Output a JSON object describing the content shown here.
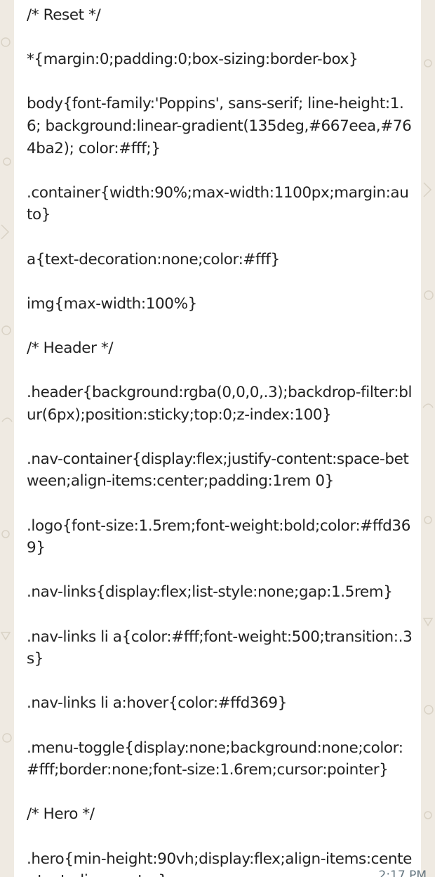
{
  "message": {
    "text": "/* Reset */\n\n*{margin:0;padding:0;box-sizing:border-box}\n\nbody{font-family:'Poppins', sans-serif; line-height:1.6; background:linear-gradient(135deg,#667eea,#764ba2); color:#fff;}\n\n.container{width:90%;max-width:1100px;margin:auto}\n\na{text-decoration:none;color:#fff}\n\nimg{max-width:100%}\n\n/* Header */\n\n.header{background:rgba(0,0,0,.3);backdrop-filter:blur(6px);position:sticky;top:0;z-index:100}\n\n.nav-container{display:flex;justify-content:space-between;align-items:center;padding:1rem 0}\n\n.logo{font-size:1.5rem;font-weight:bold;color:#ffd369}\n\n.nav-links{display:flex;list-style:none;gap:1.5rem}\n\n.nav-links li a{color:#fff;font-weight:500;transition:.3s}\n\n.nav-links li a:hover{color:#ffd369}\n\n.menu-toggle{display:none;background:none;color:#fff;border:none;font-size:1.6rem;cursor:pointer}\n\n/* Hero */\n\n.hero{min-height:90vh;display:flex;align-items:center;text-align:center}",
    "time": "2:17 PM"
  },
  "colors": {
    "wallpaper": "#efeae2",
    "bubble": "#ffffff",
    "text": "#222222",
    "timestamp": "#667781"
  }
}
